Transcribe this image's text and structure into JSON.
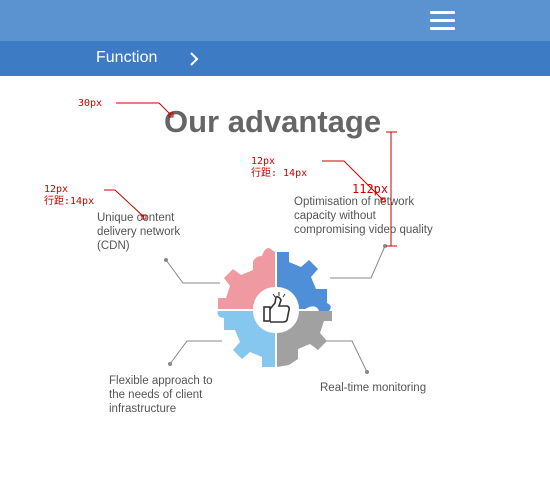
{
  "header": {
    "menu_icon": "hamburger-icon",
    "function_label": "Function",
    "chevron_icon": "chevron-right-icon"
  },
  "main": {
    "title": "Our advantage",
    "center_icon": "thumbs-up-icon",
    "features": {
      "cdn": [
        "Unique content",
        "delivery network",
        "(CDN)"
      ],
      "optimisation": [
        "Optimisation of network",
        "capacity without",
        "compromising video quality"
      ],
      "flexible": [
        "Flexible approach to",
        "the needs of client",
        "infrastructure"
      ],
      "monitoring": [
        "Real-time monitoring"
      ]
    }
  },
  "annotations": {
    "title_size": "30px",
    "left_size": "12px",
    "left_leading": "行距:14px",
    "right_size": "12px",
    "right_leading": "行距: 14px",
    "height_label": "112px"
  },
  "colors": {
    "topbar": "#5b93d1",
    "subbar": "#3d7bc5",
    "annotation": "#cc0000",
    "gear_pink": "#ef9aa0",
    "gear_blue": "#4f8fd8",
    "gear_lightblue": "#86c7f0",
    "gear_gray": "#a1a1a1"
  }
}
